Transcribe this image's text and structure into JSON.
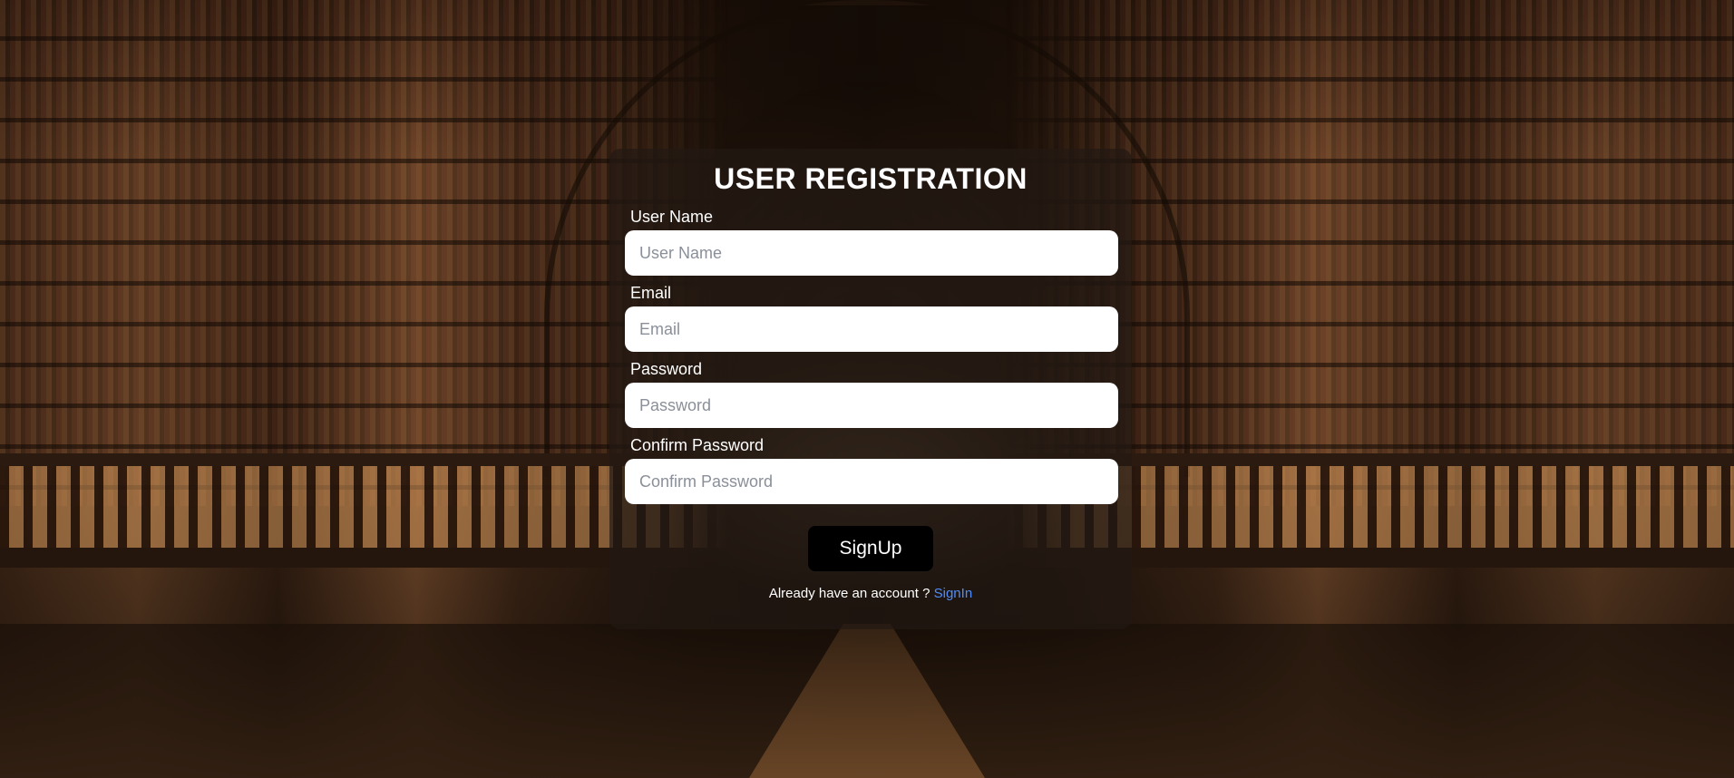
{
  "form": {
    "title": "USER REGISTRATION",
    "fields": [
      {
        "label": "User Name",
        "placeholder": "User Name",
        "value": ""
      },
      {
        "label": "Email",
        "placeholder": "Email",
        "value": ""
      },
      {
        "label": "Password",
        "placeholder": "Password",
        "value": ""
      },
      {
        "label": "Confirm Password",
        "placeholder": "Confirm Password",
        "value": ""
      }
    ],
    "submit_label": "SignUp",
    "signin_prompt": "Already have an account ?",
    "signin_link": "SignIn"
  },
  "colors": {
    "card_bg": "rgba(35,25,20,0.72)",
    "button_bg": "#000000",
    "link": "#4d8dff",
    "text": "#ffffff"
  }
}
